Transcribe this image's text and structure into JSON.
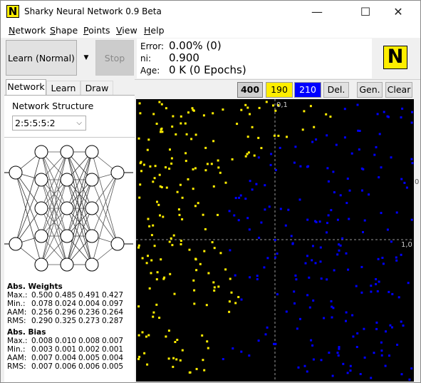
{
  "window": {
    "title": "Sharky Neural Network 0.9 Beta",
    "icon_letter": "N",
    "minimize_glyph": "—",
    "maximize_glyph": "☐",
    "close_glyph": "✕"
  },
  "menu": [
    {
      "underline": "N",
      "rest": "etwork"
    },
    {
      "underline": "S",
      "rest": "hape"
    },
    {
      "underline": "P",
      "rest": "oints"
    },
    {
      "underline": "V",
      "rest": "iew"
    },
    {
      "underline": "H",
      "rest": "elp"
    }
  ],
  "toolbar": {
    "learn_label": "Learn (Normal)",
    "dropdown_glyph": "▼",
    "stop_label": "Stop"
  },
  "stats": {
    "error_label": "Error:",
    "error_value": "0.00% (0)",
    "ni_label": "ni:",
    "ni_value": "0.900",
    "age_label": "Age:",
    "age_value": "0 K (0 Epochs)"
  },
  "logo_letter": "N",
  "tabs": [
    "Network",
    "Learn",
    "Draw"
  ],
  "network_structure": {
    "label": "Network Structure",
    "value": "2:5:5:5:2",
    "chevron": "⌵",
    "layers": [
      2,
      5,
      5,
      5,
      2
    ]
  },
  "weights": {
    "title": "Abs. Weights",
    "rows": [
      {
        "label": "Max.:",
        "values": [
          "0.500",
          "0.485",
          "0.491",
          "0.427"
        ]
      },
      {
        "label": "Min.:",
        "values": [
          "0.078",
          "0.024",
          "0.004",
          "0.097"
        ]
      },
      {
        "label": "AAM:",
        "values": [
          "0.256",
          "0.296",
          "0.236",
          "0.264"
        ]
      },
      {
        "label": "RMS:",
        "values": [
          "0.290",
          "0.325",
          "0.273",
          "0.287"
        ]
      }
    ]
  },
  "bias": {
    "title": "Abs. Bias",
    "rows": [
      {
        "label": "Max.:",
        "values": [
          "0.008",
          "0.010",
          "0.008",
          "0.007"
        ]
      },
      {
        "label": "Min.:",
        "values": [
          "0.003",
          "0.001",
          "0.002",
          "0.001"
        ]
      },
      {
        "label": "AAM:",
        "values": [
          "0.007",
          "0.004",
          "0.005",
          "0.004"
        ]
      },
      {
        "label": "RMS:",
        "values": [
          "0.007",
          "0.006",
          "0.006",
          "0.005"
        ]
      }
    ]
  },
  "points_toolbar": {
    "total": "400",
    "yellow_count": "190",
    "blue_count": "210",
    "del_label": "Del.",
    "gen_label": "Gen.",
    "clear_label": "Clear"
  },
  "plot": {
    "top_axis_label": "0,1",
    "right_axis_label": "1,0",
    "right_edge_label": "0",
    "yellow_color": "#ffee00",
    "blue_color": "#0000ff",
    "background_color": "#000000",
    "crosshair_color": "#9a9a9a",
    "point_count_yellow": 190,
    "point_count_blue": 210
  }
}
